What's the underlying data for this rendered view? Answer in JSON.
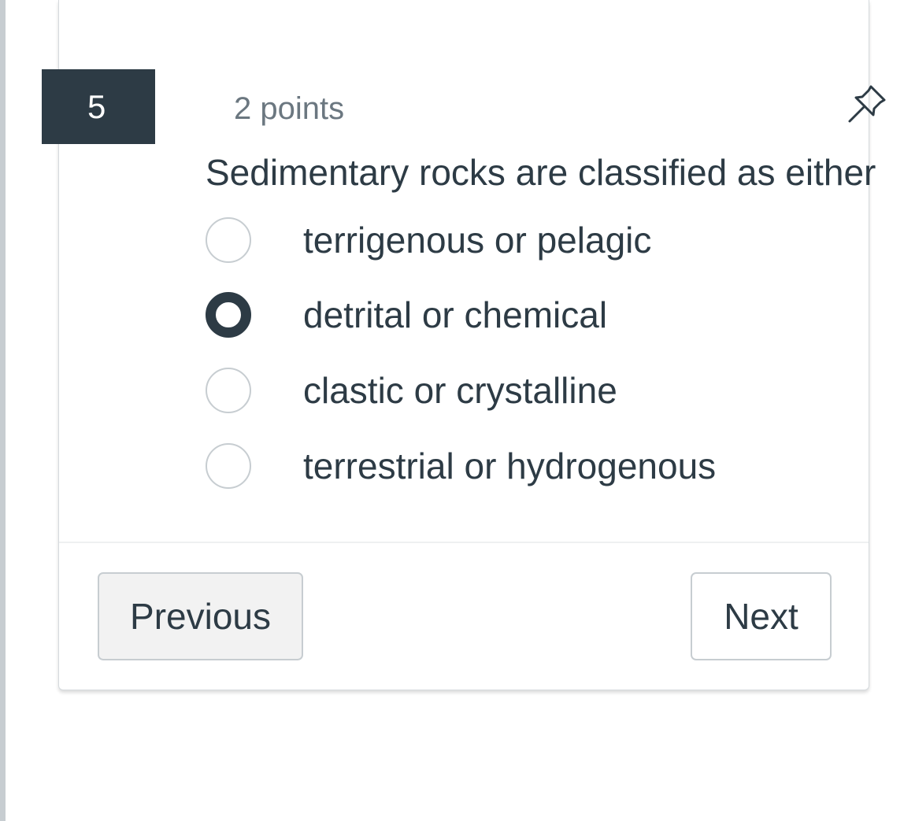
{
  "question": {
    "number": "5",
    "points": "2 points",
    "text": "Sedimentary rocks are classified as either",
    "pin_icon": "pushpin-icon",
    "answers": [
      {
        "label": "terrigenous or pelagic",
        "selected": false
      },
      {
        "label": "detrital or chemical",
        "selected": true
      },
      {
        "label": "clastic or crystalline",
        "selected": false
      },
      {
        "label": "terrestrial or hydrogenous",
        "selected": false
      }
    ]
  },
  "nav": {
    "previous_label": "Previous",
    "next_label": "Next"
  },
  "colors": {
    "primary_dark": "#2d3b45",
    "muted_text": "#6b7780",
    "border": "#c7cdd1"
  }
}
